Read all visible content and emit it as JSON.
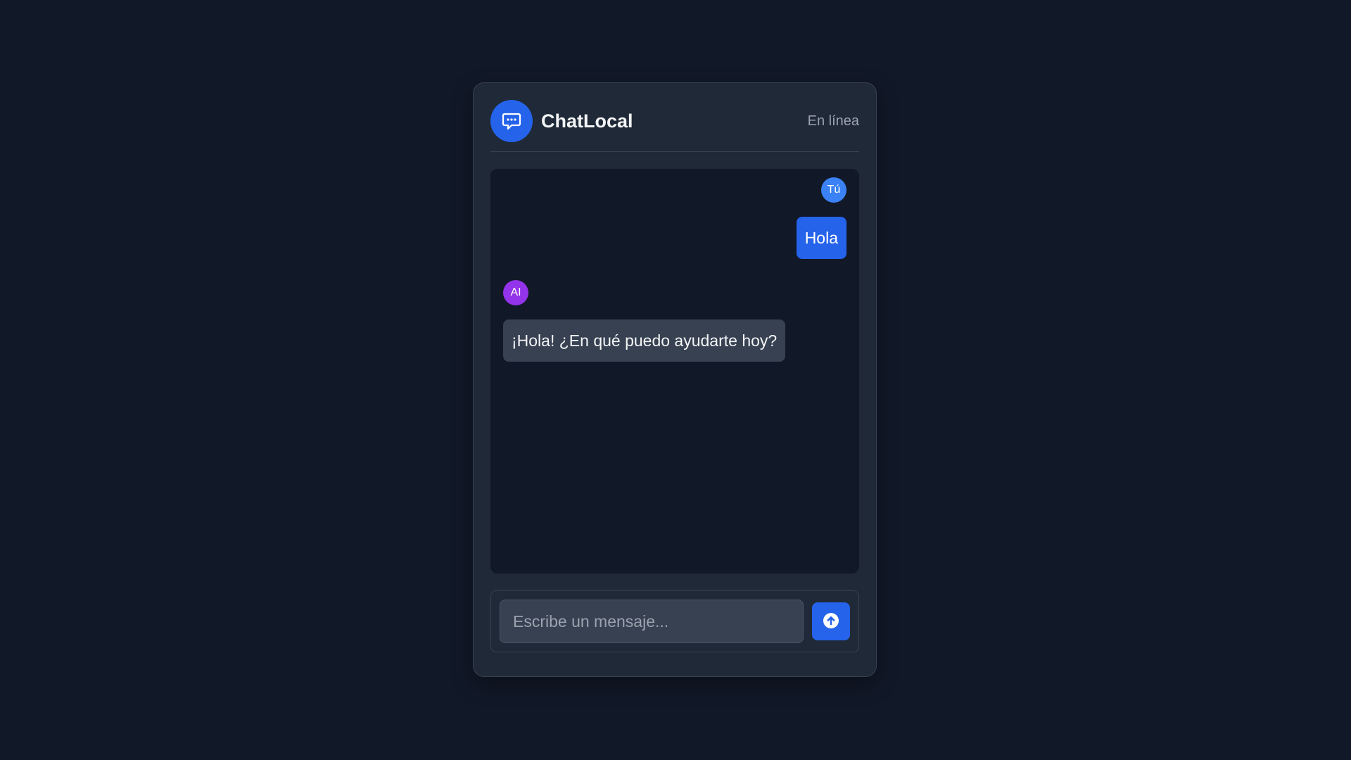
{
  "app": {
    "title": "ChatLocal",
    "status": "En línea",
    "logo_icon": "chat-bubble-icon",
    "accent_color": "#2563eb"
  },
  "messages": [
    {
      "sender": "user",
      "avatar_label": "Tú",
      "text": "Hola"
    },
    {
      "sender": "ai",
      "avatar_label": "AI",
      "text": "¡Hola! ¿En qué puedo ayudarte hoy?"
    }
  ],
  "composer": {
    "placeholder": "Escribe un mensaje...",
    "value": "",
    "send_icon": "arrow-up-circle-icon"
  }
}
